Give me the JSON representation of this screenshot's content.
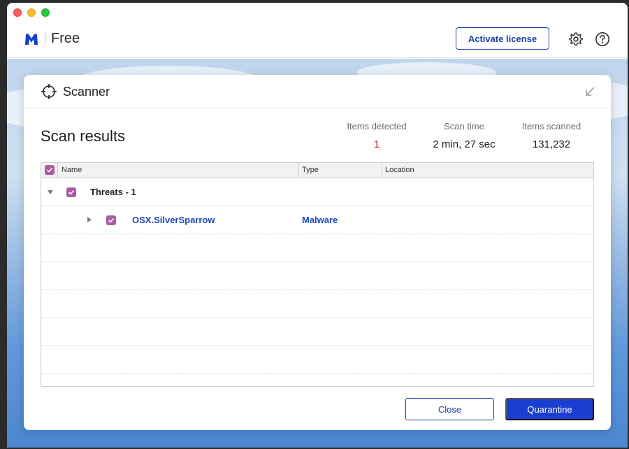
{
  "header": {
    "brand_text": "Free",
    "activate_label": "Activate license",
    "icons": [
      "gear-icon",
      "help-icon"
    ]
  },
  "scanner": {
    "title": "Scanner",
    "results_title": "Scan results",
    "stats": [
      {
        "label": "Items detected",
        "value": "1"
      },
      {
        "label": "Scan time",
        "value": "2 min, 27 sec"
      },
      {
        "label": "Items scanned",
        "value": "131,232"
      }
    ],
    "table": {
      "columns": [
        "Name",
        "Type",
        "Location"
      ],
      "group": {
        "label": "Threats - 1"
      },
      "items": [
        {
          "name": "OSX.SilverSparrow",
          "type": "Malware",
          "location": ""
        }
      ]
    },
    "buttons": {
      "close": "Close",
      "quarantine": "Quarantine"
    }
  },
  "colors": {
    "accent": "#1c3faa",
    "checkbox": "#a95ba6",
    "detected": "#d8131e"
  }
}
